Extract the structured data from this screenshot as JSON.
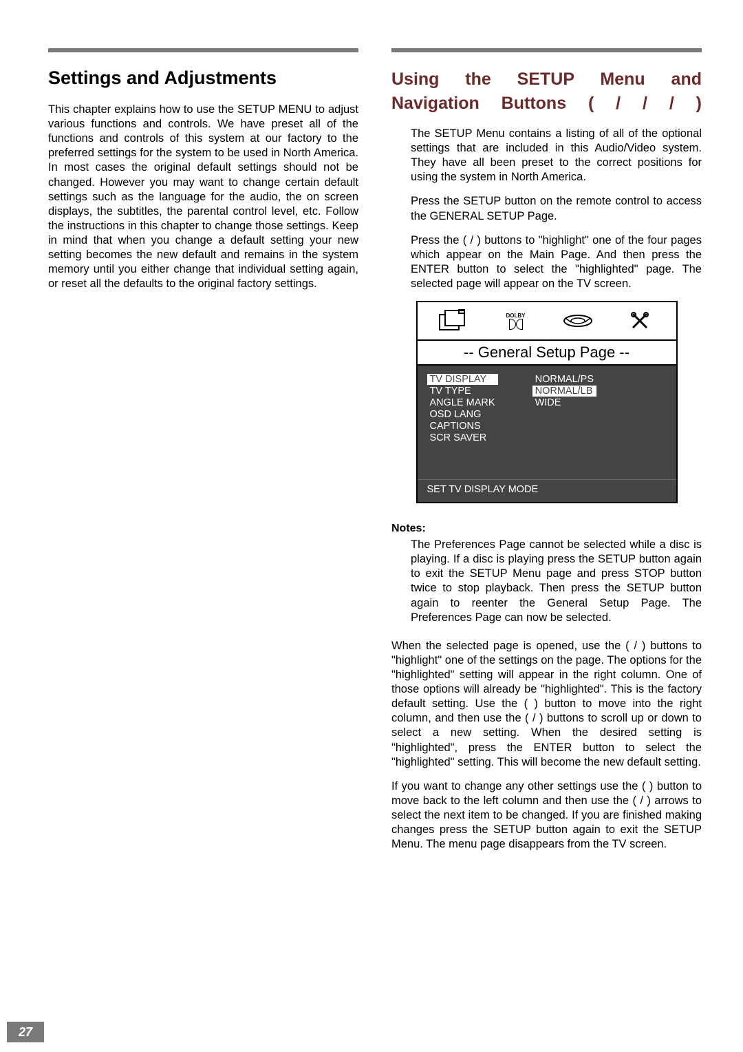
{
  "pageNumber": "27",
  "left": {
    "heading": "Settings and Adjustments",
    "para1": "This chapter explains how to use the SETUP MENU to adjust various functions and controls. We have preset all of the functions and controls of this system at our factory to the preferred settings for the system to be used in North America. In most cases the original default settings should not be changed. However you may want to change certain default settings such as the language for the audio, the on screen displays, the subtitles, the parental control level, etc. Follow the instructions in this chapter to change those settings. Keep in mind that when you change a default setting your new setting becomes the new default and remains in the system memory until you either change that individual setting again, or reset all the defaults to the original factory settings."
  },
  "right": {
    "heading": "Using the SETUP Menu and Navigation Buttons (    /    /    /    )",
    "para1": "The SETUP Menu contains a listing of all of the optional settings that are included in this Audio/Video system. They have all been preset to the correct positions for using the system in North America.",
    "para2": "Press the SETUP button on the remote control to access the GENERAL SETUP Page.",
    "para3": "Press the (    /    ) buttons to \"highlight\" one of the four pages which appear on the Main Page. And then press the ENTER button to select the \"highlighted\" page. The selected page will appear on the TV screen.",
    "notesLabel": "Notes:",
    "note1": "The Preferences Page cannot be selected while a disc is playing. If a disc is playing press the SETUP button again to exit the SETUP Menu page and press STOP button twice to stop playback. Then press the SETUP button again to reenter the General Setup Page. The Preferences Page can now be selected.",
    "para4": "When the selected page is opened, use the (    /    ) buttons to \"highlight\" one of the settings on the page. The options for the \"highlighted\" setting will appear in the right column. One of those options will already be \"highlighted\". This is the factory default setting. Use the (    ) button to move into the right column, and then use the (    /    ) buttons to scroll up or down to select a new setting. When the desired setting is \"highlighted\", press the ENTER button to select the \"highlighted\" setting. This will become the new default setting.",
    "para5": "If you want to change any other settings use the (    ) button to move back to the left column and then use the (    /    ) arrows to select the next item to be changed. If you are finished making changes press the SETUP button again to exit the SETUP Menu. The menu page disappears from the TV screen."
  },
  "osd": {
    "dolbyLabel": "DOLBY",
    "title": "-- General Setup Page --",
    "leftItems": [
      "TV DISPLAY",
      "TV TYPE",
      "ANGLE MARK",
      "OSD LANG",
      "CAPTIONS",
      "SCR SAVER"
    ],
    "leftSelectedIndex": 0,
    "rightItems": [
      "NORMAL/PS",
      "NORMAL/LB",
      "WIDE"
    ],
    "rightSelectedIndex": 1,
    "footer": "SET TV DISPLAY MODE"
  }
}
